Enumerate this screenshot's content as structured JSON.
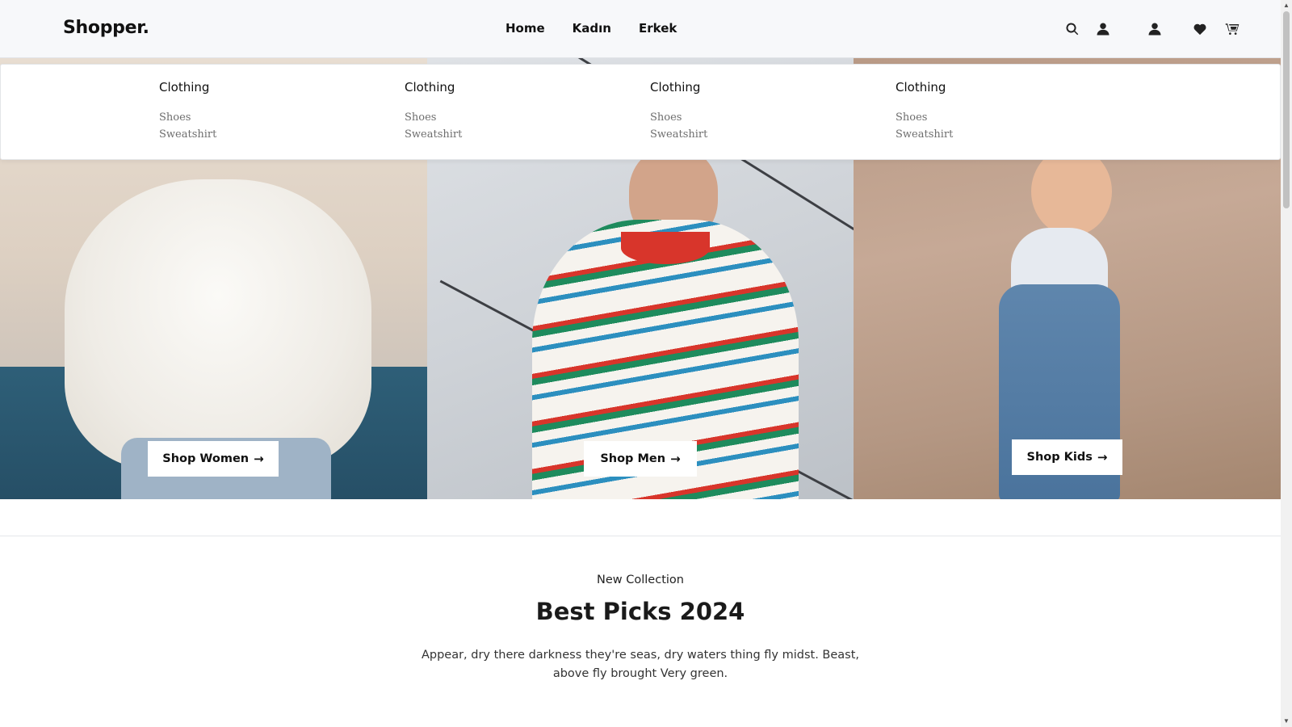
{
  "header": {
    "brand": "Shopper.",
    "nav": [
      "Home",
      "Kadın",
      "Erkek"
    ],
    "icons": [
      "search-icon",
      "user-icon",
      "user-icon",
      "heart-icon",
      "cart-icon"
    ]
  },
  "mega_menu": {
    "columns": [
      {
        "title": "Clothing",
        "links": [
          "Shoes",
          "Sweatshirt"
        ]
      },
      {
        "title": "Clothing",
        "links": [
          "Shoes",
          "Sweatshirt"
        ]
      },
      {
        "title": "Clothing",
        "links": [
          "Shoes",
          "Sweatshirt"
        ]
      },
      {
        "title": "Clothing",
        "links": [
          "Shoes",
          "Sweatshirt"
        ]
      }
    ]
  },
  "hero": {
    "buttons": [
      {
        "label": "Shop Women",
        "arrow": "→"
      },
      {
        "label": "Shop Men",
        "arrow": "→"
      },
      {
        "label": "Shop Kids",
        "arrow": "→"
      }
    ]
  },
  "collection": {
    "kicker": "New Collection",
    "title": "Best Picks 2024",
    "description": "Appear, dry there darkness they're seas, dry waters thing fly midst. Beast, above fly brought Very green."
  }
}
